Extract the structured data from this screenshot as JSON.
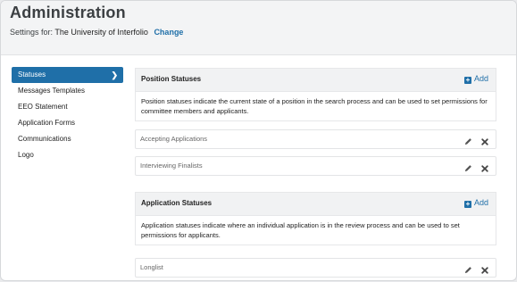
{
  "header": {
    "title": "Administration",
    "settings_label": "Settings for:",
    "institution": "The University of Interfolio",
    "change_link": "Change"
  },
  "sidebar": {
    "items": [
      {
        "label": "Statuses",
        "active": true
      },
      {
        "label": "Messages Templates"
      },
      {
        "label": "EEO Statement"
      },
      {
        "label": "Application Forms"
      },
      {
        "label": "Communications"
      },
      {
        "label": "Logo"
      }
    ]
  },
  "position_statuses": {
    "title": "Position Statuses",
    "add_label": "Add",
    "description": "Position statuses indicate the current state of a position in the search process and can be used to set permissions for committee members and applicants.",
    "rows": [
      "Accepting Applications",
      "Interviewing Finalists"
    ]
  },
  "application_statuses": {
    "title": "Application Statuses",
    "add_label": "Add",
    "description": "Application statuses indicate where an individual application is in the review process and can be used to set permissions for applicants.",
    "rows": [
      "Longlist"
    ]
  },
  "colors": {
    "accent": "#1f6fa8",
    "header_bg": "#f3f4f5",
    "section_bg": "#f1f2f3"
  },
  "icons": {
    "sidebar_active": "chevron-right-icon",
    "add": "plus-icon",
    "edit": "pencil-icon",
    "delete": "close-icon"
  }
}
